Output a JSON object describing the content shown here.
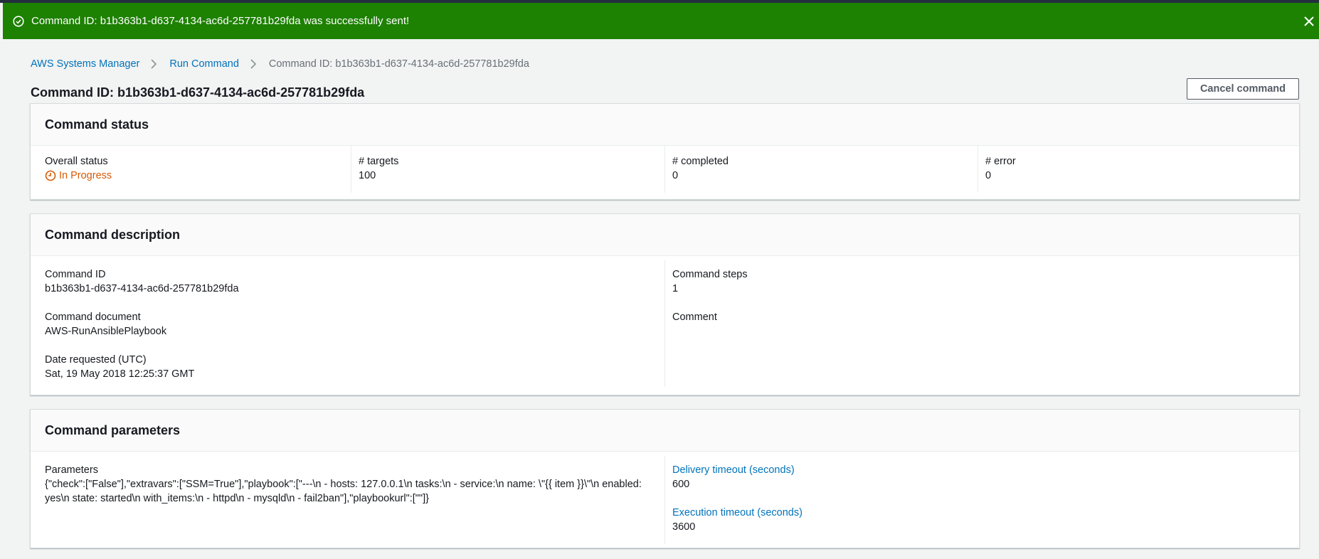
{
  "flash": {
    "message": "Command ID: b1b363b1-d637-4134-ac6d-257781b29fda was successfully sent!",
    "color": "#1d8102"
  },
  "breadcrumb": {
    "items": [
      "AWS Systems Manager",
      "Run Command"
    ],
    "current": "Command ID: b1b363b1-d637-4134-ac6d-257781b29fda"
  },
  "page": {
    "title": "Command ID: b1b363b1-d637-4134-ac6d-257781b29fda",
    "cancel_label": "Cancel command"
  },
  "status_panel": {
    "title": "Command status",
    "overall_label": "Overall status",
    "overall_value": "In Progress",
    "targets_label": "# targets",
    "targets_value": "100",
    "completed_label": "# completed",
    "completed_value": "0",
    "error_label": "# error",
    "error_value": "0",
    "in_progress_color": "#d45b07"
  },
  "description_panel": {
    "title": "Command description",
    "command_id_label": "Command ID",
    "command_id_value": "b1b363b1-d637-4134-ac6d-257781b29fda",
    "document_label": "Command document",
    "document_value": "AWS-RunAnsiblePlaybook",
    "date_label": "Date requested (UTC)",
    "date_value": "Sat, 19 May 2018 12:25:37 GMT",
    "steps_label": "Command steps",
    "steps_value": "1",
    "comment_label": "Comment"
  },
  "parameters_panel": {
    "title": "Command parameters",
    "parameters_label": "Parameters",
    "parameters_value": "{\"check\":[\"False\"],\"extravars\":[\"SSM=True\"],\"playbook\":[\"---\\n - hosts: 127.0.0.1\\n tasks:\\n - service:\\n name: \\\"{{ item }}\\\"\\n enabled: yes\\n state: started\\n with_items:\\n - httpd\\n - mysqld\\n - fail2ban\"],\"playbookurl\":[\"\"]}",
    "delivery_label": "Delivery timeout (seconds)",
    "delivery_value": "600",
    "execution_label": "Execution timeout (seconds)",
    "execution_value": "3600"
  }
}
